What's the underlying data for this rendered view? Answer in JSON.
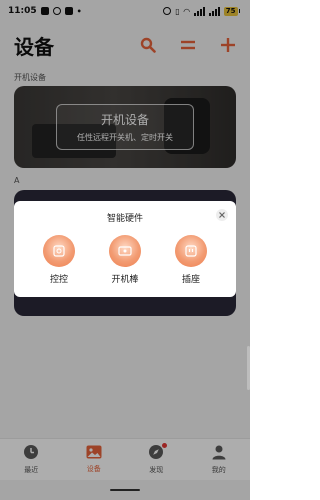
{
  "status_bar": {
    "time": "11:05",
    "battery": "75"
  },
  "header": {
    "title": "设备"
  },
  "section_power_on": {
    "label": "开机设备"
  },
  "banner": {
    "title": "开机设备",
    "subtitle": "任性远程开关机、定时开关"
  },
  "section_a": {
    "label": "A"
  },
  "modal": {
    "title": "智能硬件",
    "options": [
      {
        "label": "控控",
        "icon": "remote-control-icon"
      },
      {
        "label": "开机棒",
        "icon": "power-stick-icon"
      },
      {
        "label": "插座",
        "icon": "socket-icon"
      }
    ]
  },
  "bottom_nav": {
    "items": [
      {
        "label": "最近",
        "icon": "clock-icon"
      },
      {
        "label": "设备",
        "icon": "picture-icon",
        "active": true
      },
      {
        "label": "发现",
        "icon": "compass-icon",
        "badge": true
      },
      {
        "label": "我的",
        "icon": "user-icon"
      }
    ]
  },
  "colors": {
    "accent": "#e8643c",
    "banner_bg": "#3a3836",
    "overlay": "rgba(0,0,0,0.32)"
  }
}
